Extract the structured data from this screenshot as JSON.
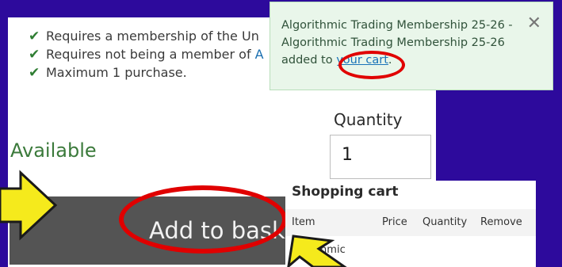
{
  "requirements": [
    {
      "text": "Requires a membership of the Un"
    },
    {
      "text": "Requires not being a member of ",
      "link": "A"
    },
    {
      "text": "Maximum 1 purchase."
    }
  ],
  "availability": "Available",
  "quantity": {
    "label": "Quantity",
    "value": "1"
  },
  "add_button": {
    "label": "Add to baske"
  },
  "toast": {
    "message_line1": "Algorithmic Trading Membership 25-26 -",
    "message_line2": "Algorithmic Trading Membership 25-26",
    "message_prefix": "added to ",
    "link": "your cart",
    "message_suffix": ".",
    "close": "✕"
  },
  "cart": {
    "title": "Shopping cart",
    "columns": [
      "Item",
      "Price",
      "Quantity",
      "Remove"
    ],
    "first_item": "rithmic"
  },
  "colors": {
    "background": "#2d0a9c",
    "highlight_ring": "#e00000",
    "pointer_arrow": "#f5ea1c",
    "available_green": "#3b7a3b"
  }
}
